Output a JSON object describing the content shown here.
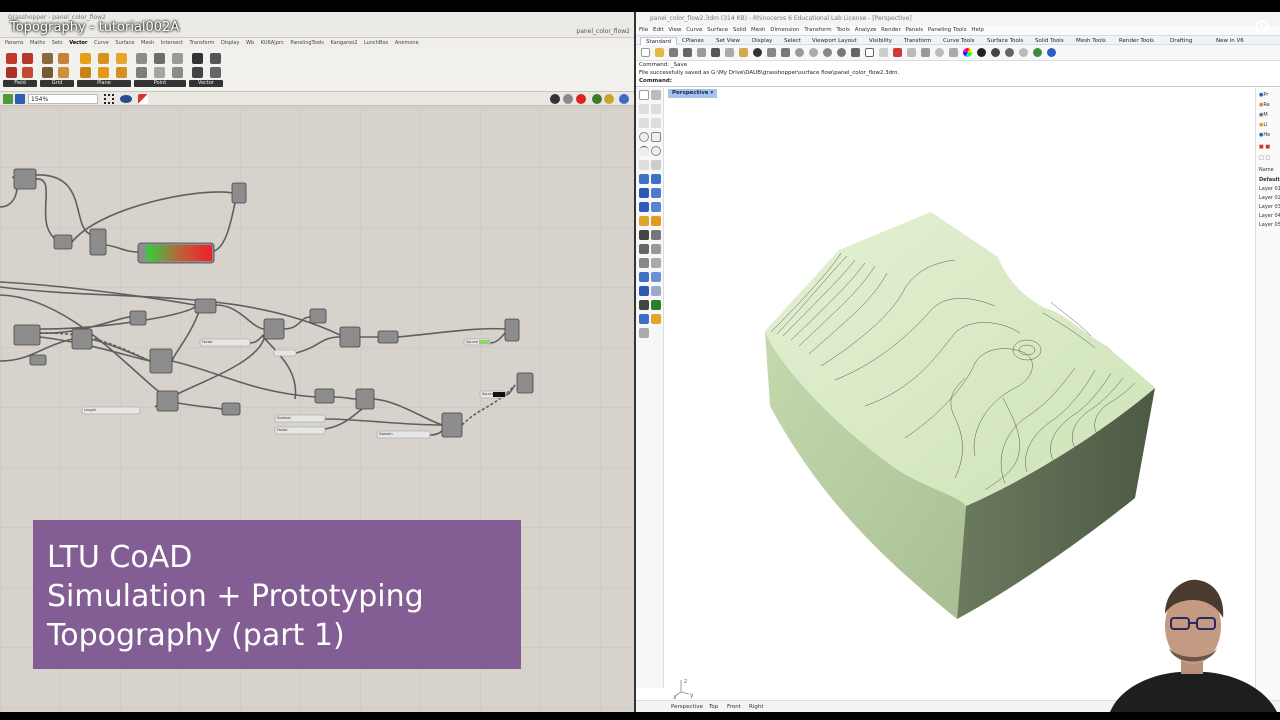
{
  "video": {
    "title": "Topography - tutorial002A"
  },
  "lower_third": {
    "line1": "LTU CoAD",
    "line2": "Simulation + Prototyping",
    "line3": "Topography (part 1)"
  },
  "grasshopper": {
    "window_title": "Grasshopper - panel_color_flow2",
    "document_name": "panel_color_flow2",
    "menu": [
      "Params",
      "Maths",
      "Sets",
      "Vector",
      "Curve",
      "Surface",
      "Mesh",
      "Intersect",
      "Transform",
      "Display",
      "Wb",
      "KUKA|prc",
      "PanelingTools",
      "Kangaroo2",
      "LunchBox",
      "Anemone"
    ],
    "ribbon_groups": [
      "Field",
      "Grid",
      "Plane",
      "Point",
      "Vector"
    ],
    "zoom": "154%",
    "nodes": {
      "slider1": "Length",
      "slider2": "Factor",
      "panel1": "Source",
      "panel2": "Source",
      "slider3": "Number",
      "slider4": "Factor",
      "slider5": "Domain"
    }
  },
  "rhino": {
    "window_title": "panel_color_flow2.3dm (314 KB) - Rhinoceros 6 Educational Lab License - [Perspective]",
    "menu": [
      "File",
      "Edit",
      "View",
      "Curve",
      "Surface",
      "Solid",
      "Mesh",
      "Dimension",
      "Transform",
      "Tools",
      "Analyze",
      "Render",
      "Panels",
      "Paneling Tools",
      "Help"
    ],
    "tabs": [
      "Standard",
      "CPlanes",
      "Set View",
      "Display",
      "Select",
      "Viewport Layout",
      "Visibility",
      "Transform",
      "Curve Tools",
      "Surface Tools",
      "Solid Tools",
      "Mesh Tools",
      "Render Tools",
      "Drafting",
      "New in V6"
    ],
    "command_history": [
      "Command: _Save",
      "File successfully saved as G:\\My Drive\\DAUB\\grasshopper\\surface flow\\panel_color_flow2.3dm."
    ],
    "command_prompt": "Command:",
    "viewport_label": "Perspective",
    "viewport_tabs": [
      "Perspective",
      "Top",
      "Front",
      "Right"
    ],
    "axis_labels": {
      "z": "z",
      "x": "x",
      "y": "y"
    },
    "panel": {
      "tabs": [
        "Pr",
        "Re",
        "M",
        "Li",
        "He"
      ],
      "header": "Name",
      "layers": [
        "Default",
        "Layer 01",
        "Layer 02",
        "Layer 03",
        "Layer 04",
        "Layer 05"
      ]
    },
    "colors": {
      "terrain_top": "#dcebc9",
      "terrain_side_left": "#b9cfa4",
      "terrain_side_right": "#5d6b52",
      "viewport_tab_bg": "#a7c3ea"
    }
  },
  "colors": {
    "lower_third_bg": "#835e95",
    "grasshopper_canvas": "#d7d3cc"
  }
}
